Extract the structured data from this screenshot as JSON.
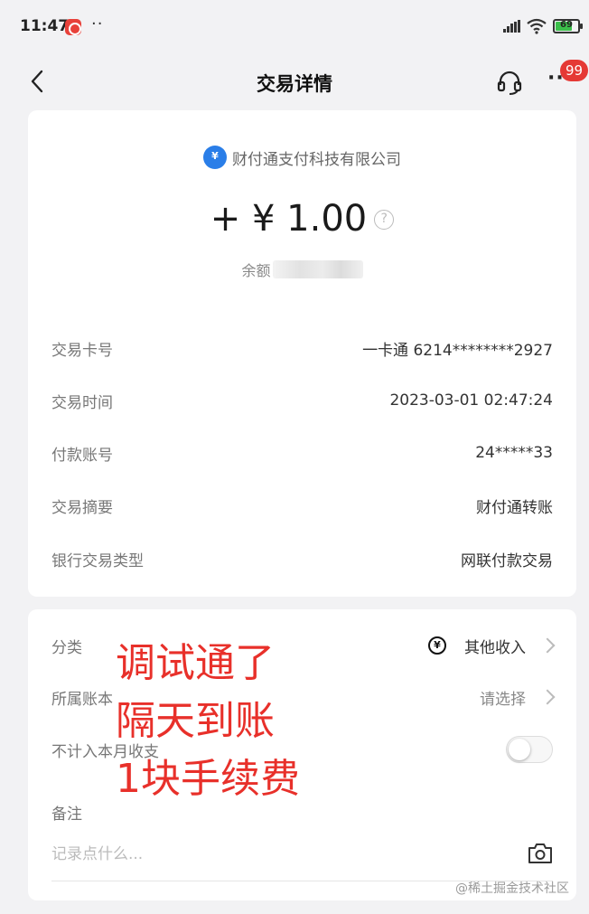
{
  "status_bar": {
    "time": "11:47",
    "dots": "··",
    "battery": "69"
  },
  "nav": {
    "title": "交易详情",
    "more": "···",
    "badge": "99"
  },
  "summary": {
    "merchant": "财付通支付科技有限公司",
    "amount": "+ ¥ 1.00",
    "help": "?",
    "balance_label": "余额"
  },
  "details": [
    {
      "label": "交易卡号",
      "value": "一卡通 6214********2927"
    },
    {
      "label": "交易时间",
      "value": "2023-03-01 02:47:24"
    },
    {
      "label": "付款账号",
      "value": "24*****33"
    },
    {
      "label": "交易摘要",
      "value": "财付通转账"
    },
    {
      "label": "银行交易类型",
      "value": "网联付款交易"
    }
  ],
  "settings": {
    "category_label": "分类",
    "category_value": "其他收入",
    "category_icon": "¥",
    "ledger_label": "所属账本",
    "ledger_value": "请选择",
    "exclude_label": "不计入本月收支",
    "exclude_on": false,
    "note_label": "备注",
    "note_placeholder": "记录点什么..."
  },
  "annotation": [
    "调试通了",
    "隔天到账",
    "1块手续费"
  ],
  "watermark": "@稀土掘金技术社区",
  "colors": {
    "accent_red": "#e53935",
    "annotation_red": "#e8302a",
    "merchant_blue": "#2a7ee8",
    "battery_green": "#3bbf4a"
  }
}
